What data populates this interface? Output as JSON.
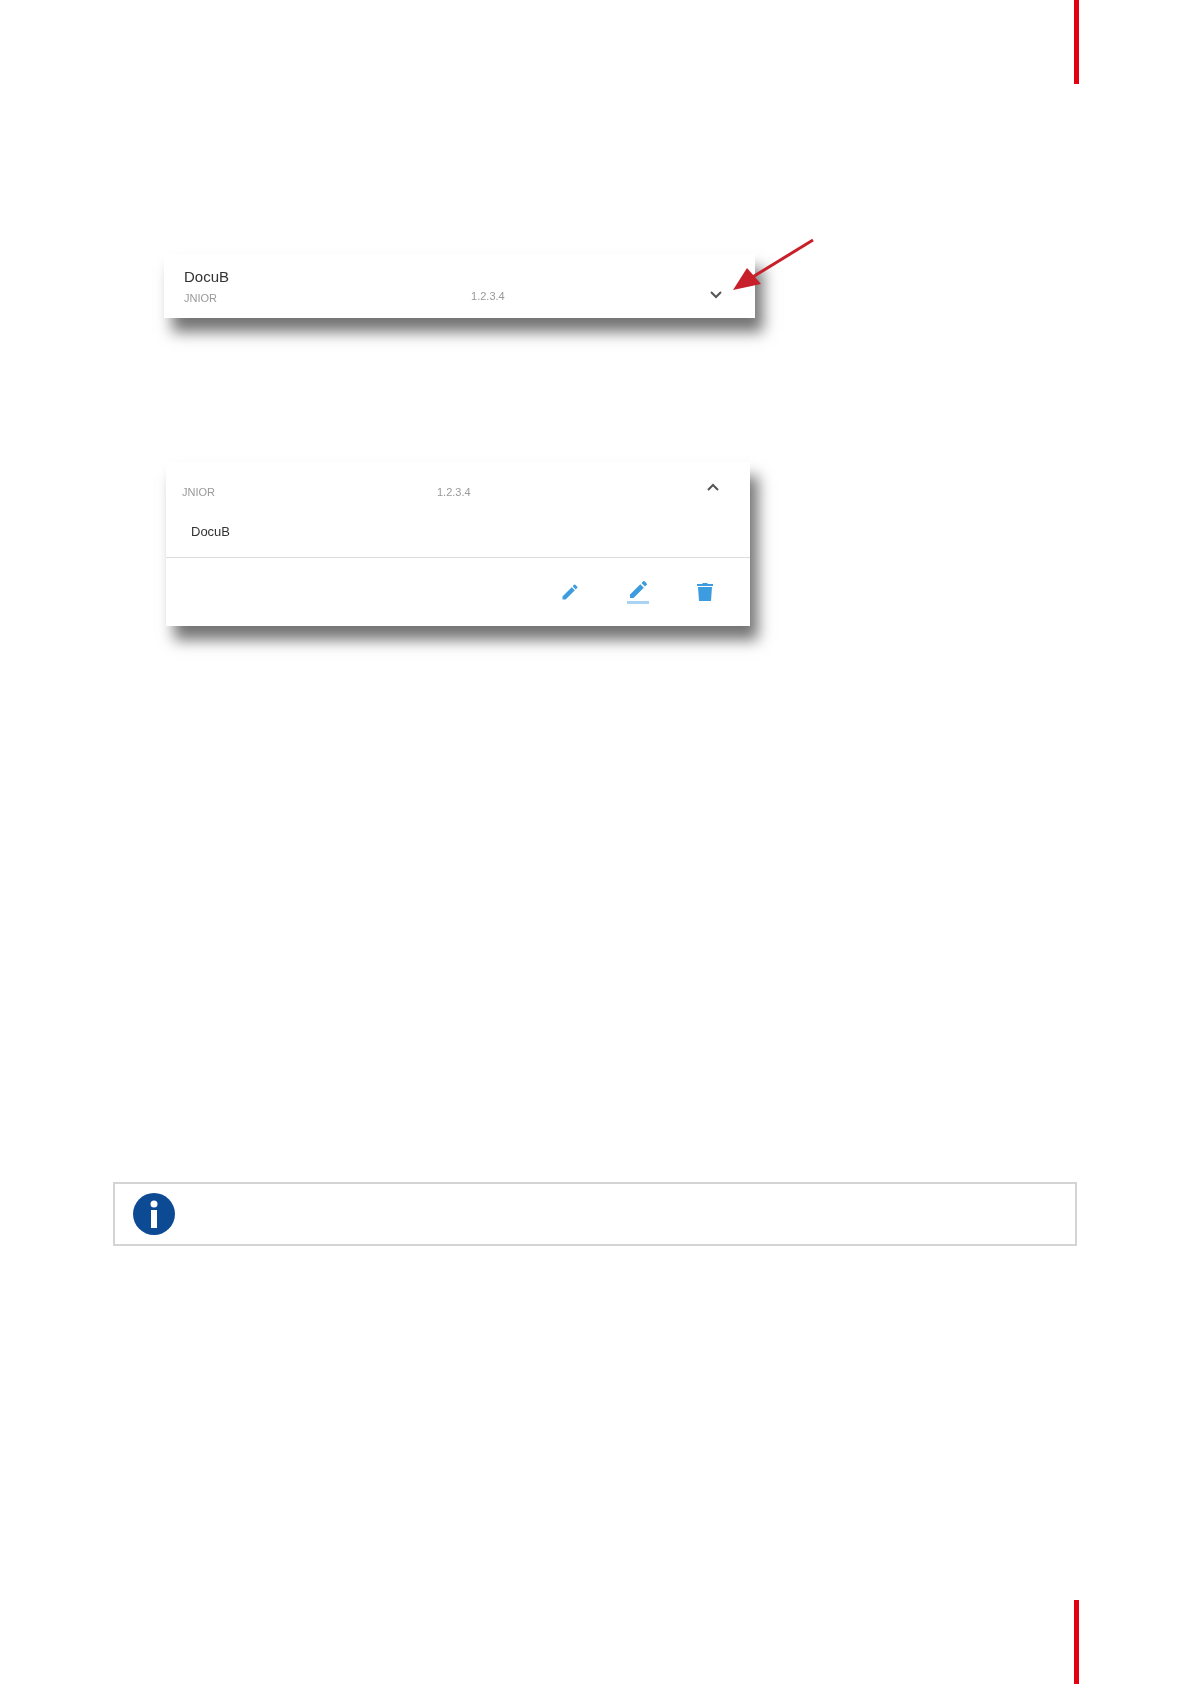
{
  "cards": [
    {
      "title": "DocuB",
      "device": "JNIOR",
      "address": "1.2.3.4",
      "expanded": false
    },
    {
      "title": "DocuB",
      "device": "JNIOR",
      "address": "1.2.3.4",
      "expanded": true,
      "actions": [
        {
          "kind": "edit"
        },
        {
          "kind": "edit-underlined"
        },
        {
          "kind": "delete"
        }
      ]
    }
  ],
  "note": {
    "kind": "info"
  }
}
